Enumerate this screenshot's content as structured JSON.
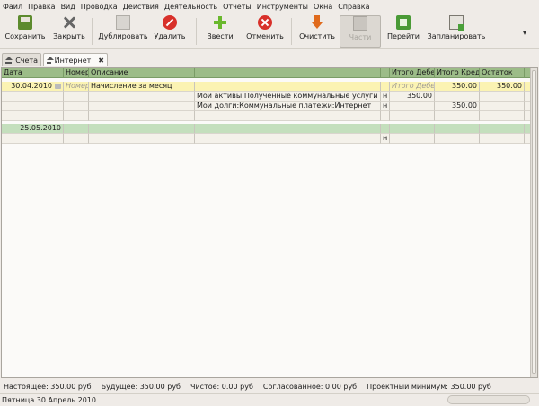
{
  "menu": [
    "Файл",
    "Правка",
    "Вид",
    "Проводка",
    "Действия",
    "Деятельность",
    "Отчеты",
    "Инструменты",
    "Окна",
    "Справка"
  ],
  "toolbar": {
    "save": "Сохранить",
    "close": "Закрыть",
    "duplicate": "Дублировать",
    "delete": "Удалить",
    "enter": "Ввести",
    "cancel": "Отменить",
    "clear": "Очистить",
    "split": "Части",
    "jump": "Перейти",
    "schedule": "Запланировать",
    "more": "▾"
  },
  "tabs": [
    {
      "label": "Счета"
    },
    {
      "label": "Интернет",
      "close": "✖"
    }
  ],
  "register": {
    "headers": {
      "date": "Дата",
      "num": "Номер",
      "desc": "Описание",
      "transfer": "",
      "r": "",
      "debit": "Итого Дебе",
      "credit": "Итого Кред",
      "balance": "Остаток"
    },
    "rows": [
      {
        "date": "30.04.2010",
        "num": "Номер",
        "desc": "Начисление за месяц",
        "debit": "Итого Дебет",
        "credit": "350.00",
        "balance": "350.00"
      },
      {
        "account": "Мои активы:Полученные коммунальные услуги",
        "r": "н",
        "debit": "350.00",
        "credit": ""
      },
      {
        "account": "Мои долги:Коммунальные платежи:Интернет",
        "r": "н",
        "debit": "",
        "credit": "350.00"
      },
      {
        "date": "25.05.2010"
      },
      {
        "r": "н"
      }
    ]
  },
  "summary": {
    "present": "Настоящее: 350.00 руб",
    "future": "Будущее: 350.00 руб",
    "cleared": "Чистое: 0.00 руб",
    "reconciled": "Согласованное: 0.00 руб",
    "projected": "Проектный минимум: 350.00 руб"
  },
  "status": "Пятница 30 Апрель 2010",
  "colors": {
    "header_bg": "#9cbc88",
    "selected_row": "#fbf3b3",
    "blank_txn": "#c4dfbd"
  }
}
